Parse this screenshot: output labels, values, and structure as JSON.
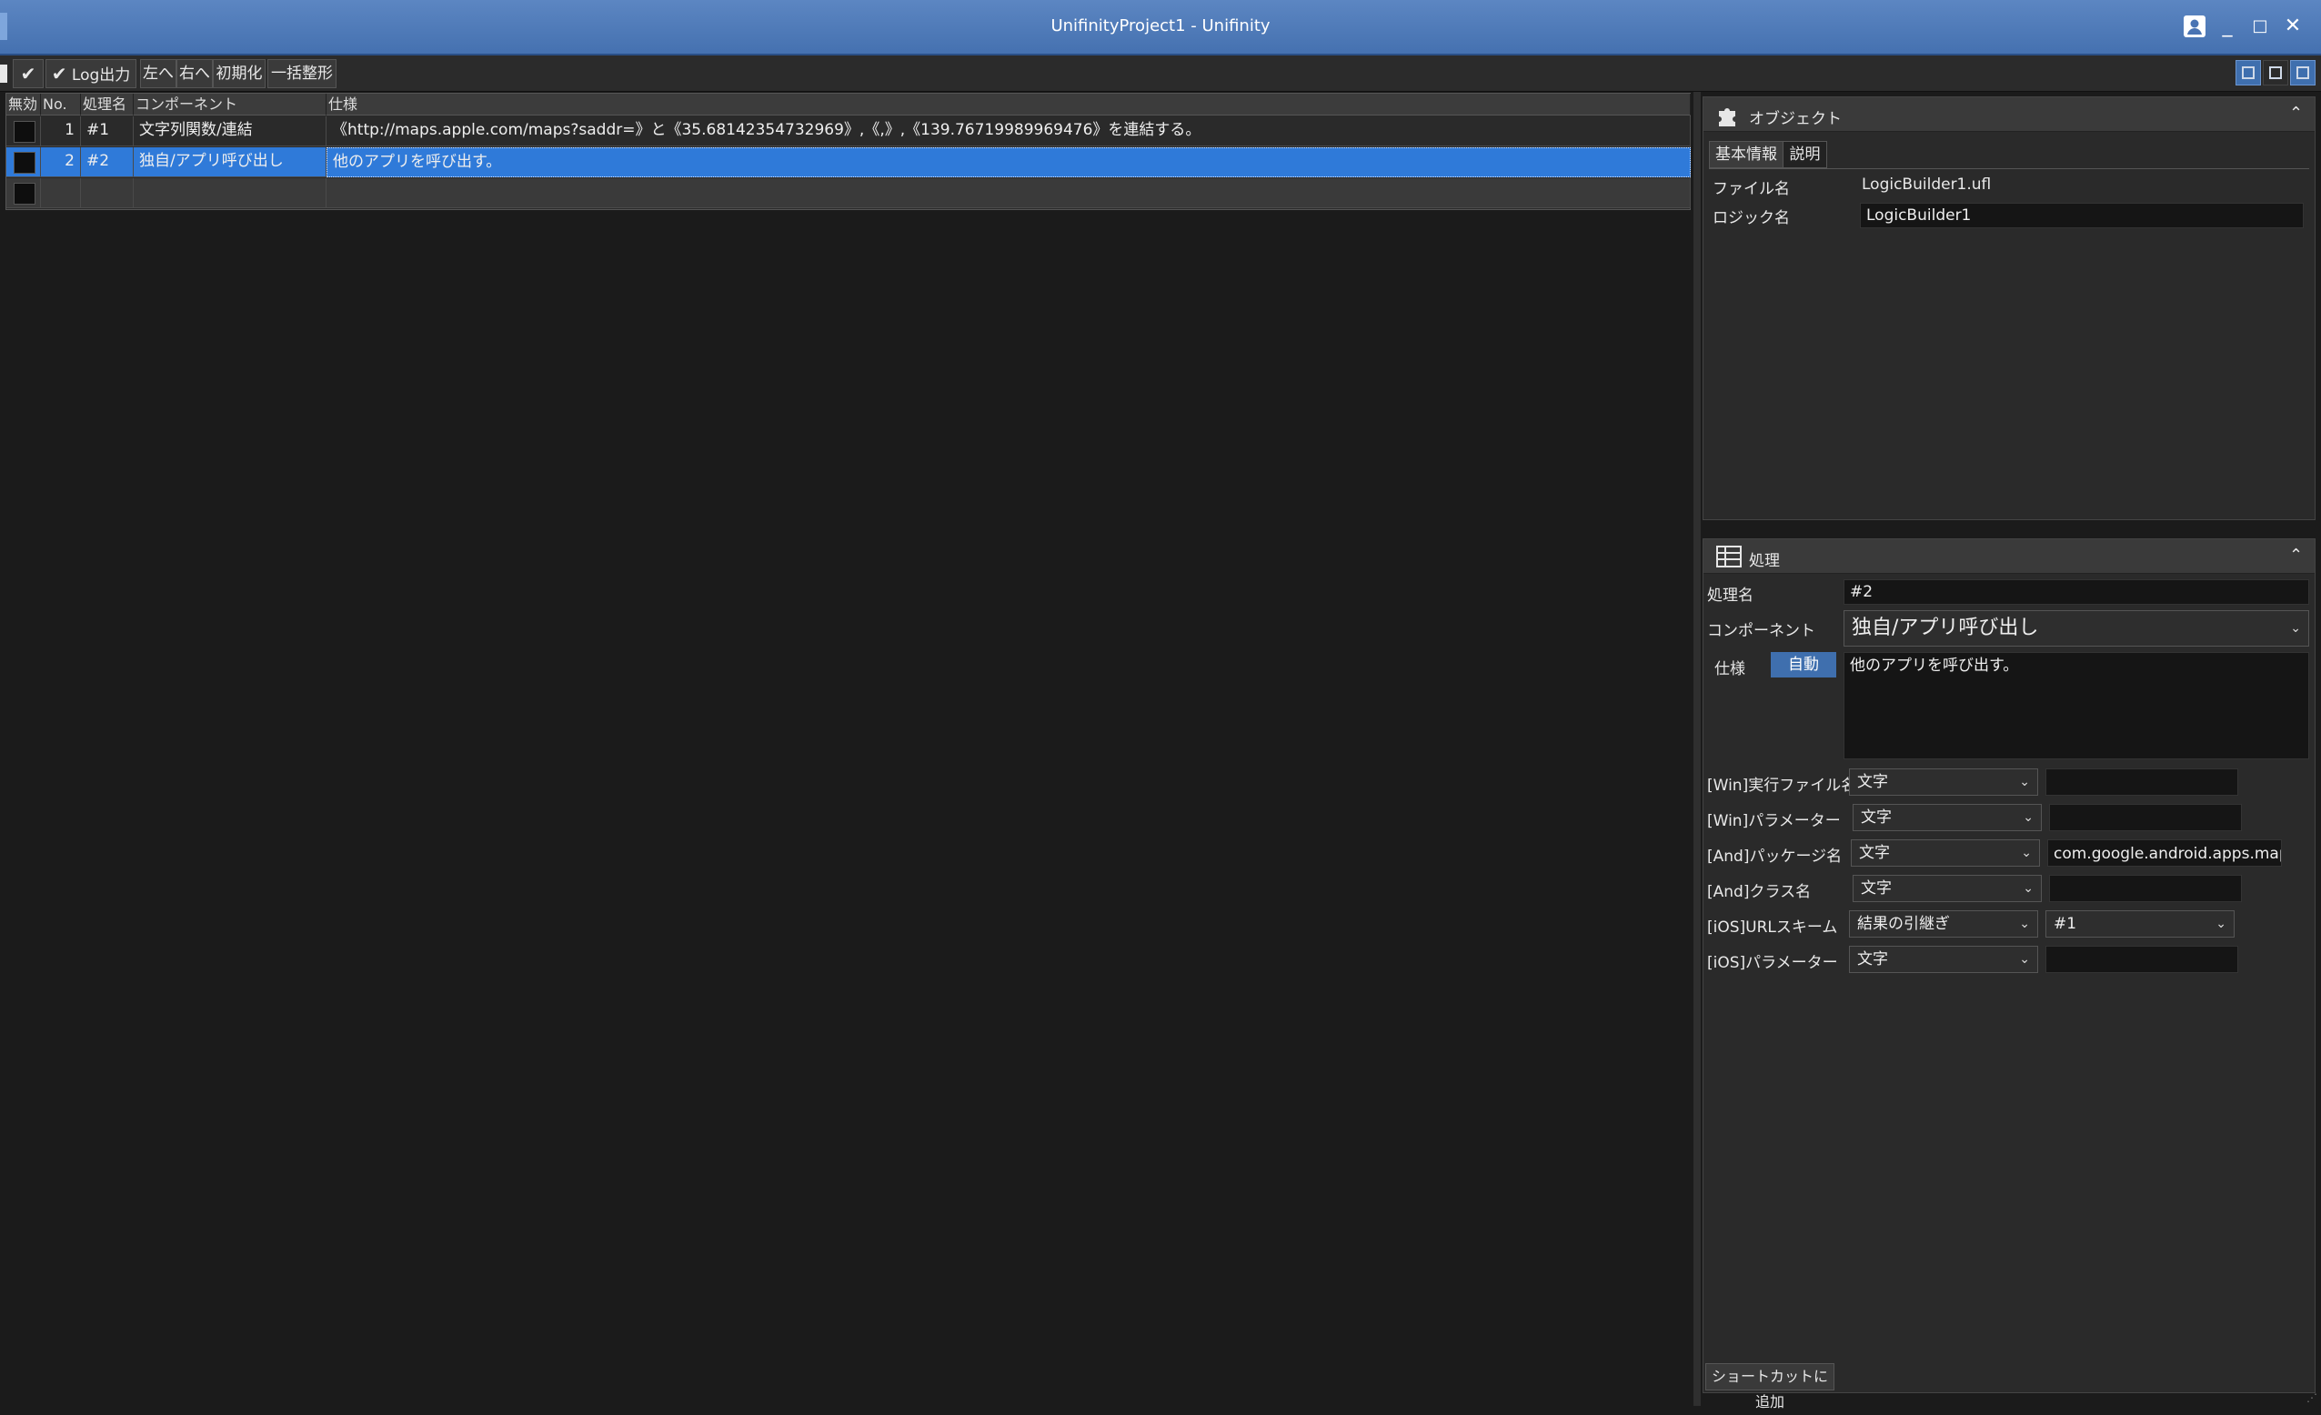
{
  "window": {
    "title": "UnifinityProject1 - Unifinity",
    "controls": {
      "minimize": "_",
      "maximize": "□",
      "close": "✕"
    }
  },
  "toolbar": {
    "log_output": "Log出力",
    "left": "左へ",
    "right": "右へ",
    "reset": "初期化",
    "format_all": "一括整形"
  },
  "grid": {
    "columns": [
      "無効",
      "No.",
      "処理名",
      "コンポーネント",
      "仕様"
    ],
    "rows": [
      {
        "no": "1",
        "name": "#1",
        "component": "文字列関数/連結",
        "spec": "《http://maps.apple.com/maps?saddr=》と《35.68142354732969》,《,》,《139.76719989969476》を連結する。",
        "selected": false
      },
      {
        "no": "2",
        "name": "#2",
        "component": "独自/アプリ呼び出し",
        "spec": "他のアプリを呼び出す。",
        "selected": true
      }
    ]
  },
  "object_panel": {
    "title": "オブジェクト",
    "tabs": [
      "基本情報",
      "説明"
    ],
    "file_label": "ファイル名",
    "file_value": "LogicBuilder1.ufl",
    "logic_label": "ロジック名",
    "logic_value": "LogicBuilder1"
  },
  "process_panel": {
    "title": "処理",
    "name_label": "処理名",
    "name_value": "#2",
    "component_label": "コンポーネント",
    "component_value": "独自/アプリ呼び出し",
    "spec_label": "仕様",
    "spec_auto": "自動",
    "spec_value": "他のアプリを呼び出す。",
    "params": [
      {
        "label": "[Win]実行ファイル名",
        "type": "文字",
        "value": ""
      },
      {
        "label": "[Win]パラメーター",
        "type": "文字",
        "value": ""
      },
      {
        "label": "[And]パッケージ名",
        "type": "文字",
        "value": "com.google.android.apps.maps"
      },
      {
        "label": "[And]クラス名",
        "type": "文字",
        "value": ""
      },
      {
        "label": "[iOS]URLスキーム",
        "type": "結果の引継ぎ",
        "value": "#1"
      },
      {
        "label": "[iOS]パラメーター",
        "type": "文字",
        "value": ""
      }
    ],
    "shortcut_button": "ショートカットに追加"
  }
}
